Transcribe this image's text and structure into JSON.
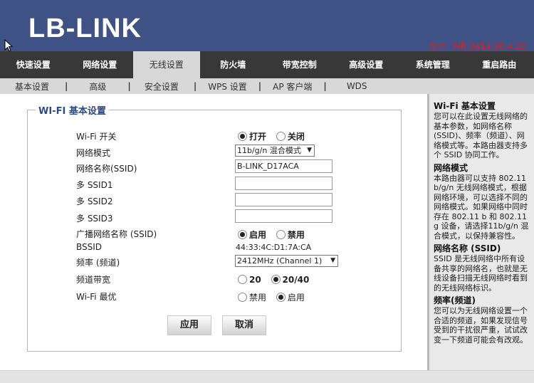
{
  "brand": {
    "logo": "LB-LINK",
    "version": "版本: WR 2414.20.4.2z"
  },
  "main_nav": [
    {
      "label": "快速设置"
    },
    {
      "label": "网络设置"
    },
    {
      "label": "无线设置"
    },
    {
      "label": "防火墙"
    },
    {
      "label": "带宽控制"
    },
    {
      "label": "高级设置"
    },
    {
      "label": "系统管理"
    },
    {
      "label": "重启路由"
    }
  ],
  "main_nav_active": "无线设置",
  "sub_nav": [
    {
      "label": "基本设置"
    },
    {
      "label": "高级"
    },
    {
      "label": "安全设置"
    },
    {
      "label": "WPS 设置"
    },
    {
      "label": "AP 客户端"
    },
    {
      "label": "WDS"
    }
  ],
  "form": {
    "legend": "WI-FI 基本设置",
    "wifi_switch": {
      "label": "Wi-Fi 开关",
      "on": "打开",
      "off": "关闭",
      "value": "打开"
    },
    "network_mode": {
      "label": "网络模式",
      "value": "11b/g/n 混合模式"
    },
    "ssid": {
      "label": "网络名称(SSID)",
      "value": "B-LINK_D17ACA"
    },
    "ssid1": {
      "label": "多 SSID1",
      "value": ""
    },
    "ssid2": {
      "label": "多 SSID2",
      "value": ""
    },
    "ssid3": {
      "label": "多 SSID3",
      "value": ""
    },
    "broadcast": {
      "label": "广播网络名称 (SSID)",
      "on": "启用",
      "off": "禁用",
      "value": "启用"
    },
    "bssid": {
      "label": "BSSID",
      "value": "44:33:4C:D1:7A:CA"
    },
    "channel": {
      "label": "频率 (频道)",
      "value": "2412MHz (Channel 1)"
    },
    "bandwidth": {
      "label": "频道带宽",
      "opt1": "20",
      "opt2": "20/40",
      "value": "20/40"
    },
    "wifi_optimal": {
      "label": "Wi-Fi 最优",
      "off": "禁用",
      "on": "启用",
      "value": "启用"
    },
    "apply_label": "应用",
    "cancel_label": "取消"
  },
  "help": [
    {
      "title": "Wi-Fi 基本设置",
      "text": "您可以在此设置无线网络的基本参数，如网络名称(SSID)、频率（频道）、网络模式等。本路由器支持多个 SSID 协同工作。"
    },
    {
      "title": "网络模式",
      "text": "本路由器可以支持 802.11 b/g/n 无线网络模式，根据网络环境，可以选择不同的网络模式。如果网络中同时存在 802.11 b 和 802.11 g 设备，请选择11b/g/n 混合模式，以保持兼容性。"
    },
    {
      "title": "网络名称 (SSID)",
      "text": "SSID 是无线网络中所有设备共享的网络名，也就是无线设备扫描无线网络时看到的无线网络标识。"
    },
    {
      "title": "频率(频道)",
      "text": "您可以为无线网络设置一个合适的频道，如果发现信号受到的干扰很严重，试试改变一下频道可能会有改观。"
    }
  ]
}
